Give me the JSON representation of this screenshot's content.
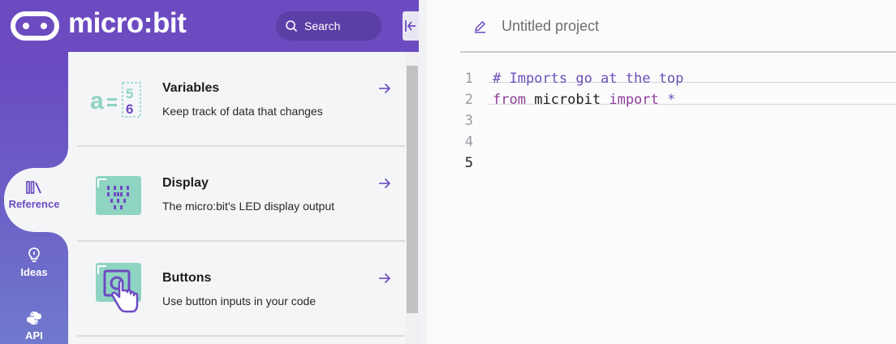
{
  "header": {
    "brand": "micro:bit",
    "search_label": "Search"
  },
  "rail": {
    "items": [
      {
        "label": "Reference",
        "icon": "books-icon",
        "active": true
      },
      {
        "label": "Ideas",
        "icon": "lightbulb-icon",
        "active": false
      },
      {
        "label": "API",
        "icon": "python-icon",
        "active": false
      }
    ]
  },
  "reference": {
    "cards": [
      {
        "title": "Variables",
        "description": "Keep track of data that changes",
        "icon": "variables-illustration"
      },
      {
        "title": "Display",
        "description": "The micro:bit's LED display output",
        "icon": "display-illustration"
      },
      {
        "title": "Buttons",
        "description": "Use button inputs in your code",
        "icon": "buttons-illustration"
      }
    ]
  },
  "editor": {
    "project_name": "Untitled project",
    "line_numbers": [
      "1",
      "2",
      "3",
      "4",
      "5"
    ],
    "active_line": 5,
    "code": {
      "line1_comment": "# Imports go at the top",
      "line2_from": "from",
      "line2_module": "microbit",
      "line2_import": "import",
      "line2_star": "*"
    }
  },
  "colors": {
    "brand_purple": "#6c4bc1",
    "panel_bg": "#f4f5f7",
    "accent_teal": "#8fd3c3"
  }
}
